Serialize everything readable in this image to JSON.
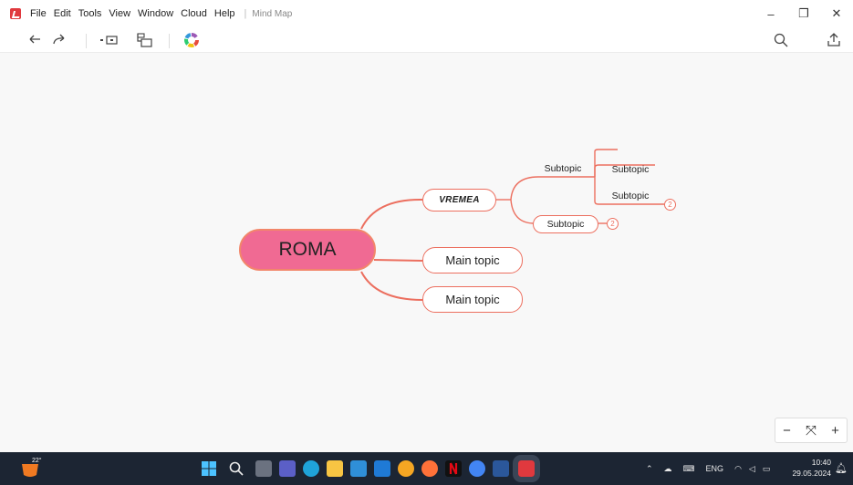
{
  "menubar": {
    "items": [
      "File",
      "Edit",
      "Tools",
      "View",
      "Window",
      "Cloud",
      "Help"
    ],
    "separator": "|",
    "doc_title": "Mind Map",
    "win_minimize": "–",
    "win_restore": "❐",
    "win_close": "✕"
  },
  "toolbar": {
    "icons": [
      "undo-icon",
      "redo-icon",
      "insert-topic-icon",
      "insert-subtopic-icon",
      "color-theme-icon",
      "search-icon",
      "share-icon"
    ]
  },
  "mindmap": {
    "central_topic": "ROMA",
    "main_topics": [
      "VREMEA",
      "Main topic",
      "Main topic"
    ],
    "subtopics": [
      {
        "label": "Subtopic",
        "boxed": false
      },
      {
        "label": "Subtopic",
        "boxed": true,
        "collapsed_count": "2"
      }
    ],
    "sub_subtopics": [
      {
        "label": "",
        "collapsed_count": ""
      },
      {
        "label": "Subtopic",
        "collapsed_count": ""
      },
      {
        "label": "Subtopic",
        "collapsed_count": "2"
      }
    ],
    "colors": {
      "central_fill": "#f06a93",
      "branch_line": "#ec6f5f",
      "canvas_bg": "#f8f8f8"
    }
  },
  "zoom_control": {
    "minus": "−",
    "fit": "⤧",
    "plus": "+"
  },
  "taskbar": {
    "weather_temp": "22°",
    "lang": "ENG",
    "time": "10:40",
    "date": "29.05.2024"
  }
}
